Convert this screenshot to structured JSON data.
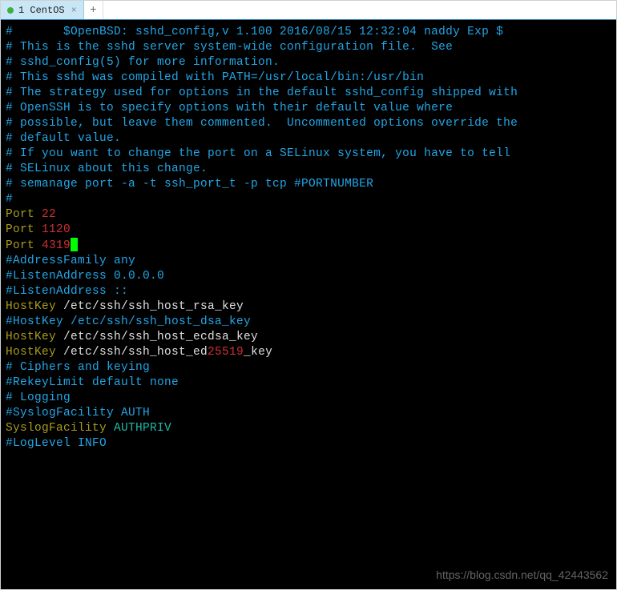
{
  "tabs": {
    "active": {
      "label": "1 CentOS"
    },
    "new_tab_glyph": "+"
  },
  "terminal": {
    "l1": "#       $OpenBSD: sshd_config,v 1.100 2016/08/15 12:32:04 naddy Exp $",
    "l2": "",
    "l3": "# This is the sshd server system-wide configuration file.  See",
    "l4": "# sshd_config(5) for more information.",
    "l5": "",
    "l6": "# This sshd was compiled with PATH=/usr/local/bin:/usr/bin",
    "l7": "",
    "l8": "# The strategy used for options in the default sshd_config shipped with",
    "l9": "# OpenSSH is to specify options with their default value where",
    "l10": "# possible, but leave them commented.  Uncommented options override the",
    "l11": "# default value.",
    "l12": "",
    "l13": "# If you want to change the port on a SELinux system, you have to tell",
    "l14": "# SELinux about this change.",
    "l15": "# semanage port -a -t ssh_port_t -p tcp #PORTNUMBER",
    "l16": "#",
    "port1_key": "Port ",
    "port1_val": "22",
    "port2_key": "Port ",
    "port2_val": "1120",
    "port3_key": "Port ",
    "port3_val": "4319",
    "l20": "#AddressFamily any",
    "l21": "#ListenAddress 0.0.0.0",
    "l22": "#ListenAddress ::",
    "l23": "",
    "hk1_key": "HostKey ",
    "hk1_val": "/etc/ssh/ssh_host_rsa_key",
    "l25": "#HostKey /etc/ssh/ssh_host_dsa_key",
    "hk3_key": "HostKey ",
    "hk3_val": "/etc/ssh/ssh_host_ecdsa_key",
    "hk4_key": "HostKey ",
    "hk4_pre": "/etc/ssh/ssh_host_ed",
    "hk4_red": "25519",
    "hk4_post": "_key",
    "l28": "",
    "l29": "# Ciphers and keying",
    "l30": "#RekeyLimit default none",
    "l31": "",
    "l32": "# Logging",
    "l33": "#SyslogFacility AUTH",
    "sf_key": "SyslogFacility ",
    "sf_val": "AUTHPRIV",
    "l35": "#LogLevel INFO"
  },
  "watermark": "https://blog.csdn.net/qq_42443562"
}
